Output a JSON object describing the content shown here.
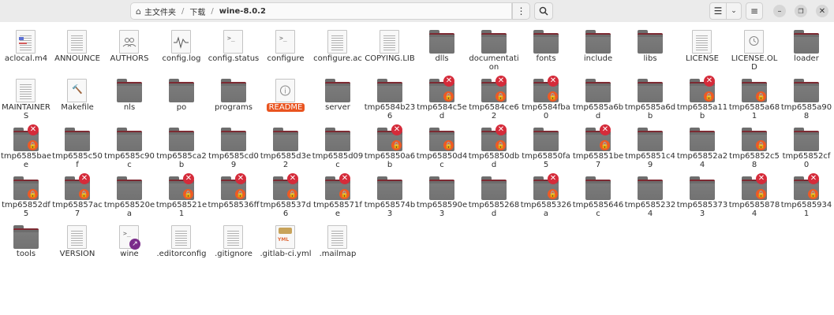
{
  "header": {
    "home_label": "主文件夹",
    "crumb_downloads": "下载",
    "crumb_current": "wine-8.0.2",
    "icons": [
      "home-icon",
      "menu-dots-icon",
      "search-icon",
      "list-view-icon",
      "chevron-down-icon",
      "hamburger-icon",
      "minimize-icon",
      "restore-icon",
      "close-icon"
    ]
  },
  "items": [
    {
      "label": "aclocal.m4",
      "kind": "m4"
    },
    {
      "label": "ANNOUNCE",
      "kind": "doc"
    },
    {
      "label": "AUTHORS",
      "kind": "authors"
    },
    {
      "label": "config.log",
      "kind": "log"
    },
    {
      "label": "config.status",
      "kind": "script"
    },
    {
      "label": "configure",
      "kind": "script"
    },
    {
      "label": "configure.ac",
      "kind": "doc"
    },
    {
      "label": "COPYING.LIB",
      "kind": "doc"
    },
    {
      "label": "dlls",
      "kind": "folder"
    },
    {
      "label": "documentation",
      "kind": "folder"
    },
    {
      "label": "fonts",
      "kind": "folder"
    },
    {
      "label": "include",
      "kind": "folder"
    },
    {
      "label": "libs",
      "kind": "folder"
    },
    {
      "label": "LICENSE",
      "kind": "doc"
    },
    {
      "label": "LICENSE.OLD",
      "kind": "license-old"
    },
    {
      "label": "loader",
      "kind": "folder"
    },
    {
      "label": "MAINTAINERS",
      "kind": "doc"
    },
    {
      "label": "Makefile",
      "kind": "makefile"
    },
    {
      "label": "nls",
      "kind": "folder"
    },
    {
      "label": "po",
      "kind": "folder"
    },
    {
      "label": "programs",
      "kind": "folder"
    },
    {
      "label": "README",
      "kind": "readme"
    },
    {
      "label": "server",
      "kind": "folder"
    },
    {
      "label": "tmp6584b236",
      "kind": "folder"
    },
    {
      "label": "tmp6584c5ed",
      "kind": "folder-locked-x"
    },
    {
      "label": "tmp6584ce62",
      "kind": "folder-locked-x"
    },
    {
      "label": "tmp6584fba0",
      "kind": "folder-locked-x"
    },
    {
      "label": "tmp6585a6bd",
      "kind": "folder"
    },
    {
      "label": "tmp6585a6db",
      "kind": "folder"
    },
    {
      "label": "tmp6585a11b",
      "kind": "folder-locked-x"
    },
    {
      "label": "tmp6585a681",
      "kind": "folder-locked"
    },
    {
      "label": "tmp6585a908",
      "kind": "folder"
    },
    {
      "label": "tmp6585baee",
      "kind": "folder-locked-x"
    },
    {
      "label": "tmp6585c50f",
      "kind": "folder"
    },
    {
      "label": "tmp6585c90c",
      "kind": "folder"
    },
    {
      "label": "tmp6585ca2b",
      "kind": "folder"
    },
    {
      "label": "tmp6585cd09",
      "kind": "folder"
    },
    {
      "label": "tmp6585d3e2",
      "kind": "folder"
    },
    {
      "label": "tmp6585d09c",
      "kind": "folder"
    },
    {
      "label": "tmp65850a6b",
      "kind": "folder-locked-x"
    },
    {
      "label": "tmp65850d4c",
      "kind": "folder-locked"
    },
    {
      "label": "tmp65850dbd",
      "kind": "folder-locked-x"
    },
    {
      "label": "tmp65850fa5",
      "kind": "folder"
    },
    {
      "label": "tmp65851be7",
      "kind": "folder-locked-x"
    },
    {
      "label": "tmp65851c49",
      "kind": "folder"
    },
    {
      "label": "tmp65852a24",
      "kind": "folder"
    },
    {
      "label": "tmp65852c58",
      "kind": "folder-locked"
    },
    {
      "label": "tmp65852cf0",
      "kind": "folder"
    },
    {
      "label": "tmp65852df5",
      "kind": "folder-locked"
    },
    {
      "label": "tmp65857ac7",
      "kind": "folder-locked-x"
    },
    {
      "label": "tmp658520ea",
      "kind": "folder"
    },
    {
      "label": "tmp658521e1",
      "kind": "folder-locked-x"
    },
    {
      "label": "tmp658536ff",
      "kind": "folder-locked-x"
    },
    {
      "label": "tmp658537d6",
      "kind": "folder-locked-x"
    },
    {
      "label": "tmp658571fe",
      "kind": "folder-locked-x"
    },
    {
      "label": "tmp658574b3",
      "kind": "folder"
    },
    {
      "label": "tmp658590e3",
      "kind": "folder"
    },
    {
      "label": "tmp6585268d",
      "kind": "folder"
    },
    {
      "label": "tmp6585326a",
      "kind": "folder-locked-x"
    },
    {
      "label": "tmp6585646c",
      "kind": "folder"
    },
    {
      "label": "tmp65852324",
      "kind": "folder"
    },
    {
      "label": "tmp65853733",
      "kind": "folder"
    },
    {
      "label": "tmp65858784",
      "kind": "folder-locked-x"
    },
    {
      "label": "tmp65859341",
      "kind": "folder-locked-x"
    },
    {
      "label": "tools",
      "kind": "folder"
    },
    {
      "label": "VERSION",
      "kind": "doc"
    },
    {
      "label": "wine",
      "kind": "link-script"
    },
    {
      "label": ".editorconfig",
      "kind": "doc"
    },
    {
      "label": ".gitignore",
      "kind": "doc"
    },
    {
      "label": ".gitlab-ci.yml",
      "kind": "yml"
    },
    {
      "label": ".mailmap",
      "kind": "doc"
    }
  ]
}
